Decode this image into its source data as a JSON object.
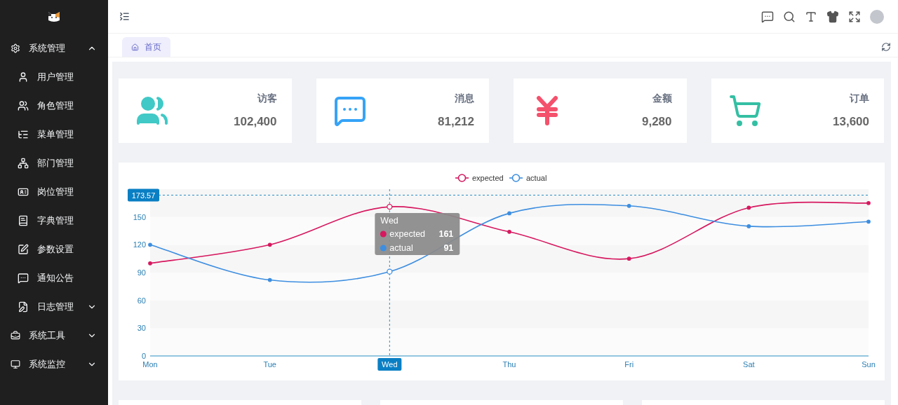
{
  "sidebar": {
    "items": [
      {
        "kind": "group",
        "label": "系统管理",
        "expanded": true,
        "children": [
          {
            "label": "用户管理"
          },
          {
            "label": "角色管理"
          },
          {
            "label": "菜单管理"
          },
          {
            "label": "部门管理"
          },
          {
            "label": "岗位管理"
          },
          {
            "label": "字典管理"
          },
          {
            "label": "参数设置"
          },
          {
            "label": "通知公告"
          },
          {
            "label": "日志管理",
            "kind": "group",
            "expanded": false
          }
        ]
      },
      {
        "kind": "group",
        "label": "系统工具",
        "expanded": false
      },
      {
        "kind": "group",
        "label": "系统监控",
        "expanded": false
      }
    ]
  },
  "tabs": [
    {
      "label": "首页",
      "selected": true
    }
  ],
  "stats": [
    {
      "label": "访客",
      "value": "102,400",
      "color": "#40c9c6"
    },
    {
      "label": "消息",
      "value": "81,212",
      "color": "#36a3f7"
    },
    {
      "label": "金额",
      "value": "9,280",
      "color": "#f4516c"
    },
    {
      "label": "订单",
      "value": "13,600",
      "color": "#34bfa3"
    }
  ],
  "chart": {
    "chart_data": {
      "type": "line",
      "categories": [
        "Mon",
        "Tue",
        "Wed",
        "Thu",
        "Fri",
        "Sat",
        "Sun"
      ],
      "series": [
        {
          "name": "expected",
          "color": "#d6185f",
          "marker": "circle",
          "values": [
            100,
            120,
            161,
            134,
            105,
            160,
            165
          ]
        },
        {
          "name": "actual",
          "color": "#3d8ee0",
          "marker": "circle",
          "values": [
            120,
            82,
            91,
            154,
            162,
            140,
            145
          ]
        }
      ],
      "legend": "top",
      "ylim": [
        0,
        180
      ],
      "yticks": [
        0,
        30,
        60,
        90,
        120,
        150
      ],
      "ref_lines": [
        {
          "axis": "y",
          "value": 173.57,
          "label": "173.57"
        },
        {
          "axis": "x",
          "value": "Wed",
          "label": "Wed"
        }
      ]
    },
    "tooltip": {
      "title": "Wed",
      "rows": [
        {
          "name": "expected",
          "value": "161"
        },
        {
          "name": "actual",
          "value": "91"
        }
      ]
    }
  }
}
